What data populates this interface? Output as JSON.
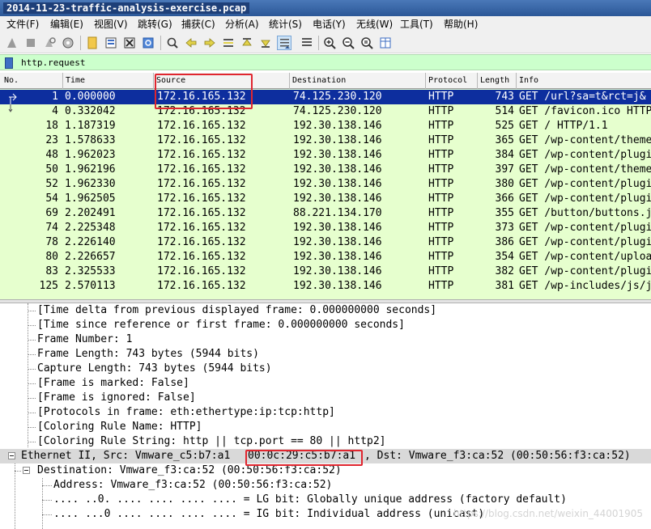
{
  "window": {
    "title": "2014-11-23-traffic-analysis-exercise.pcap"
  },
  "menu": [
    {
      "id": "file",
      "label": "文件(F)"
    },
    {
      "id": "edit",
      "label": "编辑(E)"
    },
    {
      "id": "view",
      "label": "视图(V)"
    },
    {
      "id": "go",
      "label": "跳转(G)"
    },
    {
      "id": "capture",
      "label": "捕获(C)"
    },
    {
      "id": "analyze",
      "label": "分析(A)"
    },
    {
      "id": "statistics",
      "label": "统计(S)"
    },
    {
      "id": "telephony",
      "label": "电话(Y)"
    },
    {
      "id": "wireless",
      "label": "无线(W)"
    },
    {
      "id": "tools",
      "label": "工具(T)"
    },
    {
      "id": "help",
      "label": "帮助(H)"
    }
  ],
  "toolbar_icons": [
    "shark-fin-icon",
    "stop-icon",
    "restart-icon",
    "options-gear-icon",
    "open-folder-icon",
    "save-icon",
    "close-file-icon",
    "reload-icon",
    "find-icon",
    "back-arrow-icon",
    "forward-arrow-icon",
    "goto-packet-icon",
    "first-packet-icon",
    "last-packet-icon",
    "autoscroll-icon",
    "colorize-icon",
    "zoom-in-icon",
    "zoom-out-icon",
    "zoom-normal-icon",
    "resize-columns-icon"
  ],
  "filter": {
    "value": "http.request"
  },
  "packet_list": {
    "columns": [
      "No.",
      "Time",
      "Source",
      "Destination",
      "Protocol",
      "Length",
      "Info"
    ],
    "rows": [
      {
        "no": "1",
        "time": "0.000000",
        "src": "172.16.165.132",
        "dst": "74.125.230.120",
        "proto": "HTTP",
        "len": "743",
        "info": "GET /url?sa=t&rct=j&",
        "selected": true
      },
      {
        "no": "4",
        "time": "0.332042",
        "src": "172.16.165.132",
        "dst": "74.125.230.120",
        "proto": "HTTP",
        "len": "514",
        "info": "GET /favicon.ico HTTP"
      },
      {
        "no": "18",
        "time": "1.187319",
        "src": "172.16.165.132",
        "dst": "192.30.138.146",
        "proto": "HTTP",
        "len": "525",
        "info": "GET / HTTP/1.1"
      },
      {
        "no": "23",
        "time": "1.578633",
        "src": "172.16.165.132",
        "dst": "192.30.138.146",
        "proto": "HTTP",
        "len": "365",
        "info": "GET /wp-content/theme"
      },
      {
        "no": "48",
        "time": "1.962023",
        "src": "172.16.165.132",
        "dst": "192.30.138.146",
        "proto": "HTTP",
        "len": "384",
        "info": "GET /wp-content/plugi"
      },
      {
        "no": "50",
        "time": "1.962196",
        "src": "172.16.165.132",
        "dst": "192.30.138.146",
        "proto": "HTTP",
        "len": "397",
        "info": "GET /wp-content/theme"
      },
      {
        "no": "52",
        "time": "1.962330",
        "src": "172.16.165.132",
        "dst": "192.30.138.146",
        "proto": "HTTP",
        "len": "380",
        "info": "GET /wp-content/plugi"
      },
      {
        "no": "54",
        "time": "1.962505",
        "src": "172.16.165.132",
        "dst": "192.30.138.146",
        "proto": "HTTP",
        "len": "366",
        "info": "GET /wp-content/plugi"
      },
      {
        "no": "69",
        "time": "2.202491",
        "src": "172.16.165.132",
        "dst": "88.221.134.170",
        "proto": "HTTP",
        "len": "355",
        "info": "GET /button/buttons.j"
      },
      {
        "no": "74",
        "time": "2.225348",
        "src": "172.16.165.132",
        "dst": "192.30.138.146",
        "proto": "HTTP",
        "len": "373",
        "info": "GET /wp-content/plugi"
      },
      {
        "no": "78",
        "time": "2.226140",
        "src": "172.16.165.132",
        "dst": "192.30.138.146",
        "proto": "HTTP",
        "len": "386",
        "info": "GET /wp-content/plugi"
      },
      {
        "no": "80",
        "time": "2.226657",
        "src": "172.16.165.132",
        "dst": "192.30.138.146",
        "proto": "HTTP",
        "len": "354",
        "info": "GET /wp-content/uploa"
      },
      {
        "no": "83",
        "time": "2.325533",
        "src": "172.16.165.132",
        "dst": "192.30.138.146",
        "proto": "HTTP",
        "len": "382",
        "info": "GET /wp-content/plugi"
      },
      {
        "no": "125",
        "time": "2.570113",
        "src": "172.16.165.132",
        "dst": "192.30.138.146",
        "proto": "HTTP",
        "len": "381",
        "info": "GET /wp-includes/js/j"
      }
    ]
  },
  "details": [
    {
      "id": "time-delta-displayed",
      "text": "[Time delta from previous displayed frame: 0.000000000 seconds]"
    },
    {
      "id": "time-since-reference",
      "text": "[Time since reference or first frame: 0.000000000 seconds]"
    },
    {
      "id": "frame-number",
      "text": "Frame Number: 1"
    },
    {
      "id": "frame-length",
      "text": "Frame Length: 743 bytes (5944 bits)"
    },
    {
      "id": "capture-length",
      "text": "Capture Length: 743 bytes (5944 bits)"
    },
    {
      "id": "frame-marked",
      "text": "[Frame is marked: False]"
    },
    {
      "id": "frame-ignored",
      "text": "[Frame is ignored: False]"
    },
    {
      "id": "protocols-in-frame",
      "text": "[Protocols in frame: eth:ethertype:ip:tcp:http]"
    },
    {
      "id": "coloring-rule-name",
      "text": "[Coloring Rule Name: HTTP]"
    },
    {
      "id": "coloring-rule-string",
      "text": "[Coloring Rule String: http || tcp.port == 80 || http2]"
    },
    {
      "id": "ethernet-ii",
      "text_before": "Ethernet II, Src: Vmware_c5:b7:a1 ",
      "mac": "00:0c:29:c5:b7:a1",
      "text_after": ", Dst: Vmware_f3:ca:52 (00:50:56:f3:ca:52)"
    },
    {
      "id": "destination",
      "text": "Destination: Vmware_f3:ca:52 (00:50:56:f3:ca:52)"
    },
    {
      "id": "address",
      "text": "Address: Vmware_f3:ca:52 (00:50:56:f3:ca:52)"
    },
    {
      "id": "lg-bit",
      "text": ".... ..0. .... .... .... .... = LG bit: Globally unique address (factory default)"
    },
    {
      "id": "ig-bit",
      "text": ".... ...0 .... .... .... .... = IG bit: Individual address (unicast)"
    }
  ],
  "watermark": "https://blog.csdn.net/weixin_44001905",
  "colors": {
    "row_bg": "#e6ffce",
    "selected_bg": "#0d2e9e",
    "filter_bg": "#ccffcc",
    "annotation": "#e0262f"
  }
}
